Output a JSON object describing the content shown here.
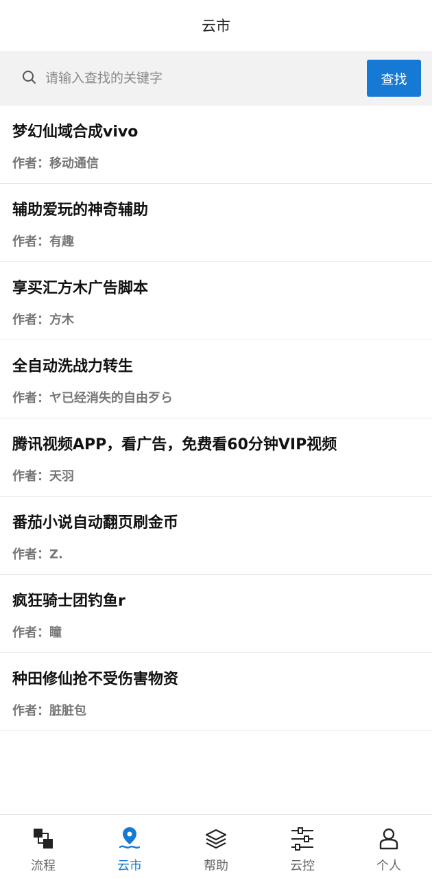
{
  "header": {
    "title": "云市"
  },
  "search": {
    "placeholder": "请输入查找的关键字",
    "button_label": "查找",
    "value": ""
  },
  "list": {
    "items": [
      {
        "title": "梦幻仙域合成vivo",
        "author": "作者：移动通信"
      },
      {
        "title": "辅助爱玩的神奇辅助",
        "author": "作者：有趣"
      },
      {
        "title": "享买汇方木广告脚本",
        "author": "作者：方木"
      },
      {
        "title": "全自动洗战力转生",
        "author": "作者：ヤ已经消失的自由歹ら"
      },
      {
        "title": "腾讯视频APP，看广告，免费看60分钟VIP视频",
        "author": "作者：天羽"
      },
      {
        "title": "番茄小说自动翻页刷金币",
        "author": "作者：Z."
      },
      {
        "title": "疯狂骑士团钓鱼r",
        "author": "作者：瞳"
      },
      {
        "title": "种田修仙抢不受伤害物资",
        "author": "作者：脏脏包"
      }
    ]
  },
  "tabbar": {
    "active_color": "#1679d4",
    "tabs": [
      {
        "label": "流程",
        "icon": "flow-icon"
      },
      {
        "label": "云市",
        "icon": "location-pin-icon",
        "active": true
      },
      {
        "label": "帮助",
        "icon": "layers-icon"
      },
      {
        "label": "云控",
        "icon": "sliders-icon"
      },
      {
        "label": "个人",
        "icon": "user-icon"
      }
    ]
  }
}
